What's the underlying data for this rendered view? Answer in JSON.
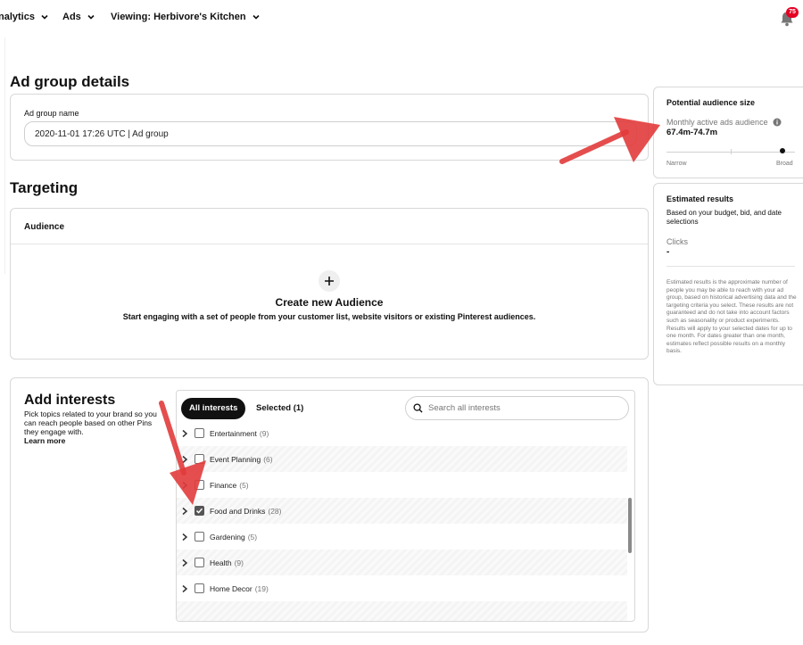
{
  "topnav": {
    "items": [
      {
        "label": "nalytics"
      },
      {
        "label": "Ads"
      },
      {
        "label": "Viewing: Herbivore's Kitchen"
      }
    ],
    "notification_count": "75"
  },
  "ad_group": {
    "heading": "Ad group details",
    "name_label": "Ad group name",
    "name_value": "2020-11-01 17:26 UTC | Ad group"
  },
  "targeting": {
    "heading": "Targeting",
    "audience_label": "Audience",
    "create_title": "Create new Audience",
    "create_desc": "Start engaging with a set of people from your customer list, website visitors or existing Pinterest audiences."
  },
  "interests": {
    "title": "Add interests",
    "description": "Pick topics related to your brand so you can reach people based on other Pins they engage with.",
    "learn_more": "Learn more",
    "tabs": {
      "all": "All interests",
      "selected": "Selected (1)"
    },
    "search_placeholder": "Search all interests",
    "items": [
      {
        "label": "Entertainment",
        "count": "(9)",
        "checked": false
      },
      {
        "label": "Event Planning",
        "count": "(6)",
        "checked": false
      },
      {
        "label": "Finance",
        "count": "(5)",
        "checked": false
      },
      {
        "label": "Food and Drinks",
        "count": "(28)",
        "checked": true
      },
      {
        "label": "Gardening",
        "count": "(5)",
        "checked": false
      },
      {
        "label": "Health",
        "count": "(9)",
        "checked": false
      },
      {
        "label": "Home Decor",
        "count": "(19)",
        "checked": false
      }
    ]
  },
  "audience_size": {
    "title": "Potential audience size",
    "metric_label": "Monthly active ads audience",
    "metric_value": "67.4m-74.7m",
    "slider_min_label": "Narrow",
    "slider_max_label": "Broad",
    "slider_position": 0.9
  },
  "estimated": {
    "title": "Estimated results",
    "subtitle": "Based on your budget, bid, and date selections",
    "clicks_label": "Clicks",
    "clicks_value": "-",
    "disclaimer": "Estimated results is the approximate number of people you may be able to reach with your ad group, based on historical advertising data and the targeting criteria you select. These results are not guaranteed and do not take into account factors such as seasonality or product experiments. Results will apply to your selected dates for up to one month. For dates greater than one month, estimates reflect possible results on a monthly basis."
  },
  "colors": {
    "accent_red": "#e60023",
    "annotation_red": "#e23b3b"
  }
}
